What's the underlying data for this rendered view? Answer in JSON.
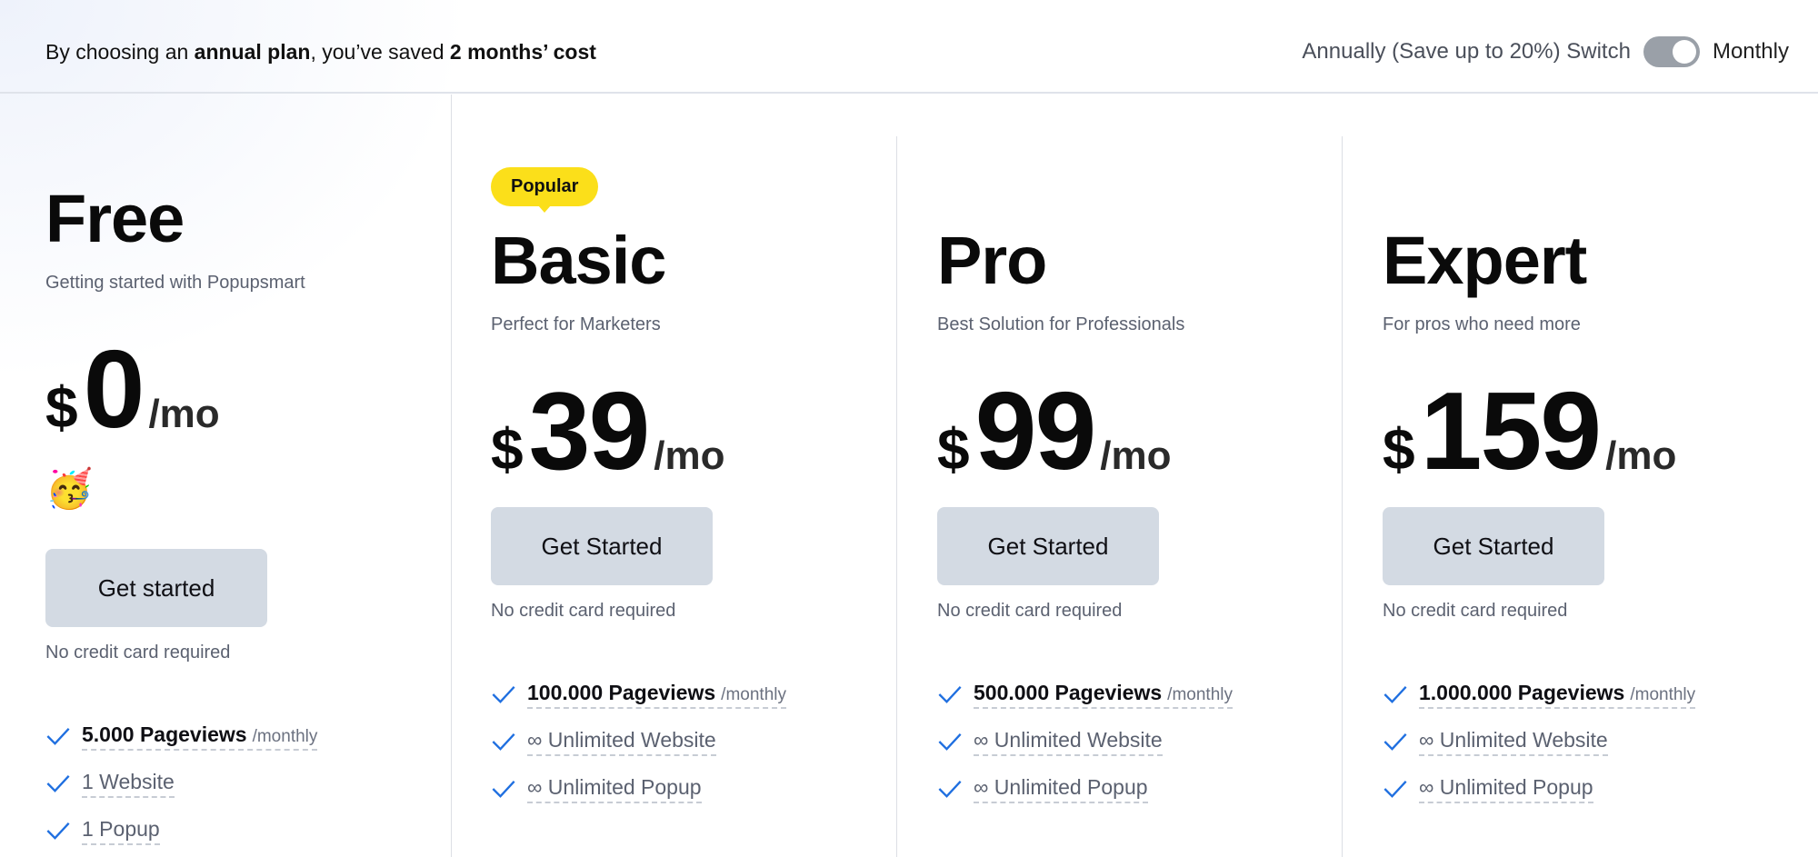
{
  "banner": {
    "prefix": "By choosing an ",
    "plan_bold": "annual plan",
    "middle": ", you’ve saved ",
    "saved_bold": "2 months’ cost"
  },
  "billing_switch": {
    "annually_label": "Annually (Save up to 20%) Switch",
    "monthly_label": "Monthly",
    "state": "monthly"
  },
  "currency": "$",
  "per_label": "/mo",
  "plans": [
    {
      "name": "Free",
      "subtitle": "Getting started with Popupsmart",
      "amount": "0",
      "emoji": "🥳",
      "cta": "Get started",
      "note": "No credit card required",
      "features": [
        {
          "bold": "5.000 Pageviews",
          "unit": "/monthly"
        },
        {
          "text": "1 Website"
        },
        {
          "text": "1 Popup"
        }
      ]
    },
    {
      "name": "Basic",
      "badge": "Popular",
      "subtitle": "Perfect for Marketers",
      "amount": "39",
      "cta": "Get Started",
      "note": "No credit card required",
      "features": [
        {
          "bold": "100.000 Pageviews",
          "unit": "/monthly"
        },
        {
          "text": "∞ Unlimited Website"
        },
        {
          "text": "∞ Unlimited Popup"
        }
      ]
    },
    {
      "name": "Pro",
      "subtitle": "Best Solution for Professionals",
      "amount": "99",
      "cta": "Get Started",
      "note": "No credit card required",
      "features": [
        {
          "bold": "500.000 Pageviews",
          "unit": "/monthly"
        },
        {
          "text": "∞ Unlimited Website"
        },
        {
          "text": "∞ Unlimited Popup"
        }
      ]
    },
    {
      "name": "Expert",
      "subtitle": "For pros who need more",
      "amount": "159",
      "cta": "Get Started",
      "note": "No credit card required",
      "features": [
        {
          "bold": "1.000.000 Pageviews",
          "unit": "/monthly"
        },
        {
          "text": "∞ Unlimited Website"
        },
        {
          "text": "∞ Unlimited Popup"
        }
      ]
    }
  ],
  "colors": {
    "accent_check": "#1f6fe0",
    "badge": "#fbdf1a",
    "button": "#d3dae3"
  },
  "icons": {
    "check": "check-icon",
    "emoji": "partying-face-emoji"
  }
}
